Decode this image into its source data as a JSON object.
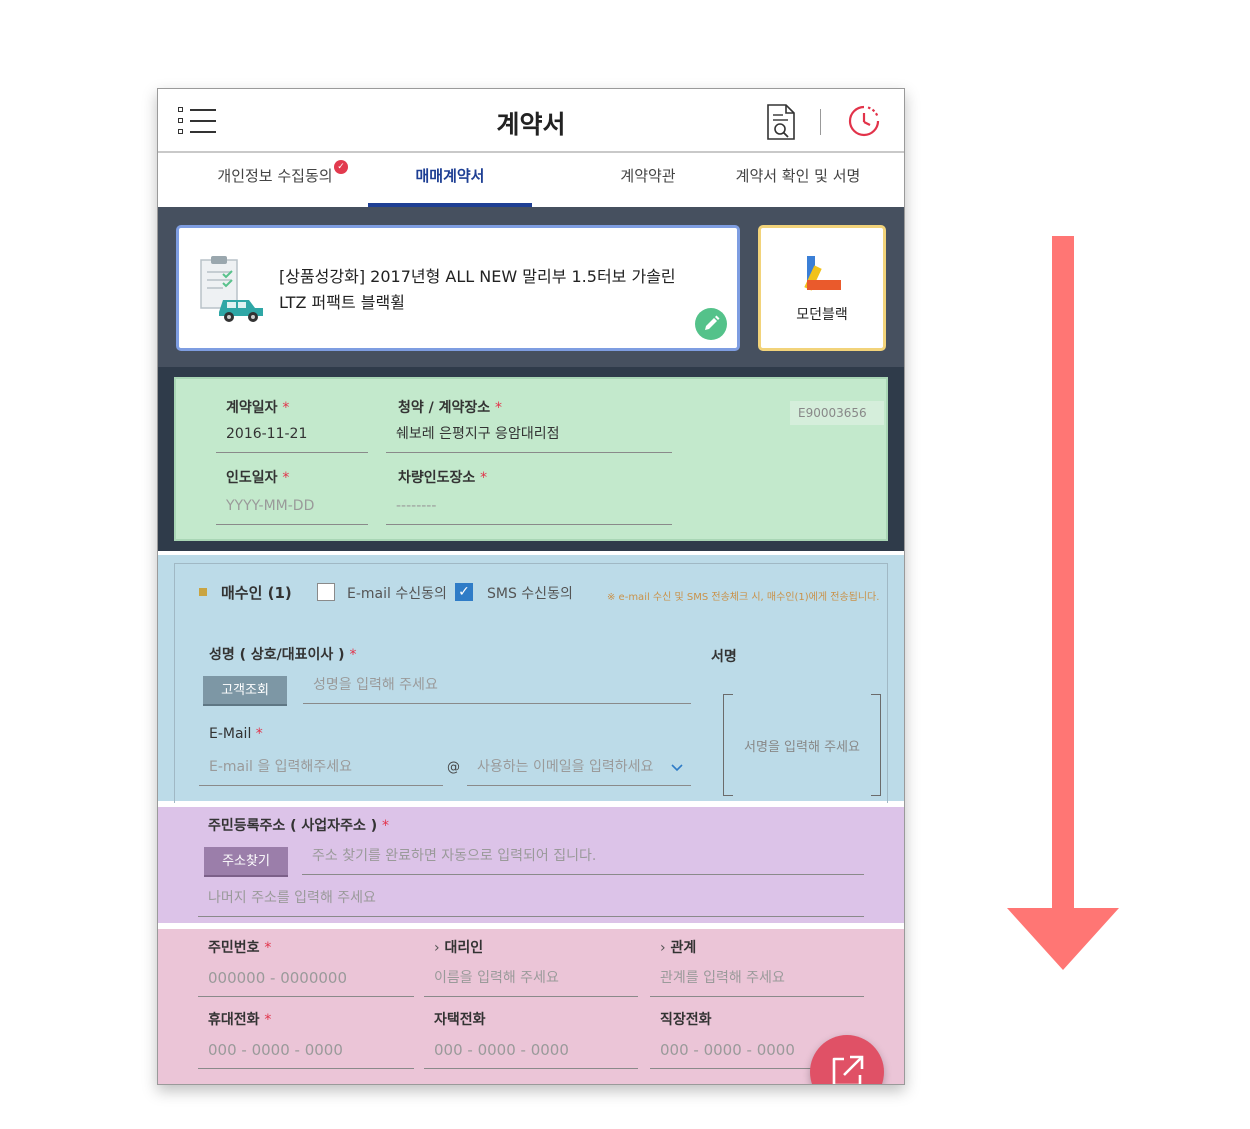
{
  "header": {
    "title": "계약서"
  },
  "tabs": [
    {
      "label": "개인정보 수집동의"
    },
    {
      "label": "매매계약서"
    },
    {
      "label": "계약약관"
    },
    {
      "label": "계약서 확인 및 서명"
    }
  ],
  "product": {
    "name": "[상품성강화] 2017년형 ALL NEW 말리부 1.5터보 가솔린 LTZ 퍼팩트 블랙휠",
    "color": "모던블랙"
  },
  "contract": {
    "contract_no": "E90003656",
    "contract_date_label": "계약일자",
    "contract_date": "2016-11-21",
    "place_label": "청약 / 계약장소",
    "place": "쉐보레 은평지구 응암대리점",
    "delivery_date_label": "인도일자",
    "delivery_date_placeholder": "YYYY-MM-DD",
    "delivery_place_label": "차량인도장소",
    "delivery_place_placeholder": "--------"
  },
  "buyer": {
    "title": "매수인 (1)",
    "email_consent": "E-mail 수신동의",
    "sms_consent": "SMS 수신동의",
    "notice": "※ e-mail 수신 및 SMS 전송체크 시, 매수인(1)에게 전송됩니다.",
    "name_label": "성명 ( 상호/대표이사 )",
    "customer_lookup": "고객조회",
    "name_placeholder": "성명을 입력해 주세요",
    "signature_label": "서명",
    "signature_placeholder": "서명을 입력해 주세요",
    "email_label": "E-Mail",
    "email_placeholder": "E-mail 을 입력해주세요",
    "at": "@",
    "domain_placeholder": "사용하는 이메일을 입력하세요"
  },
  "address": {
    "label": "주민등록주소 ( 사업자주소 )",
    "search_button": "주소찾기",
    "auto_placeholder": "주소 찾기를 완료하면 자동으로 입력되어 집니다.",
    "detail_placeholder": "나머지 주소를 입력해 주세요"
  },
  "ids": {
    "resident_no_label": "주민번호",
    "resident_no_placeholder": "000000 - 0000000",
    "agent_label": "대리인",
    "agent_placeholder": "이름을 입력해 주세요",
    "relation_label": "관계",
    "relation_placeholder": "관계를 입력해 주세요",
    "mobile_label": "휴대전화",
    "mobile_placeholder": "000 - 0000 - 0000",
    "home_label": "자택전화",
    "home_placeholder": "000 - 0000 - 0000",
    "work_label": "직장전화",
    "work_placeholder": "000 - 0000 - 0000"
  },
  "required_mark": "*",
  "colors": {
    "accent": "#1e3f94",
    "required": "#e2334a",
    "green_section": "#c3e9cc",
    "blue_section": "#bcdbe8",
    "purple_section": "#dcc3e8",
    "pink_section": "#ebc5d7",
    "arrow": "#ff7674"
  }
}
